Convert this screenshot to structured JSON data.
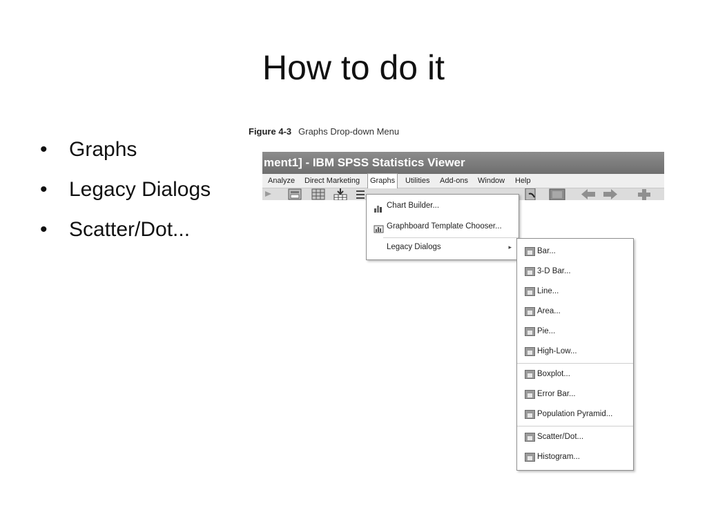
{
  "slide": {
    "title": "How to do it",
    "bullets": [
      "Graphs",
      "Legacy Dialogs",
      "Scatter/Dot..."
    ]
  },
  "figure": {
    "number": "Figure 4-3",
    "caption": "Graphs Drop-down Menu"
  },
  "window": {
    "title": "ment1] - IBM SPSS Statistics Viewer",
    "menus": [
      "Analyze",
      "Direct Marketing",
      "Graphs",
      "Utilities",
      "Add-ons",
      "Window",
      "Help"
    ],
    "active_menu": "Graphs"
  },
  "graphs_menu": {
    "items": [
      "Chart Builder...",
      "Graphboard Template Chooser...",
      "Legacy Dialogs"
    ],
    "submenu_arrow": "▸"
  },
  "legacy_dialogs_menu": {
    "items": [
      "Bar...",
      "3-D Bar...",
      "Line...",
      "Area...",
      "Pie...",
      "High-Low...",
      "Boxplot...",
      "Error Bar...",
      "Population Pyramid...",
      "Scatter/Dot...",
      "Histogram..."
    ]
  },
  "colors": {
    "titlebar": "#7a7a7a",
    "menubar": "#efefef",
    "toolbar": "#dcdcdc"
  }
}
